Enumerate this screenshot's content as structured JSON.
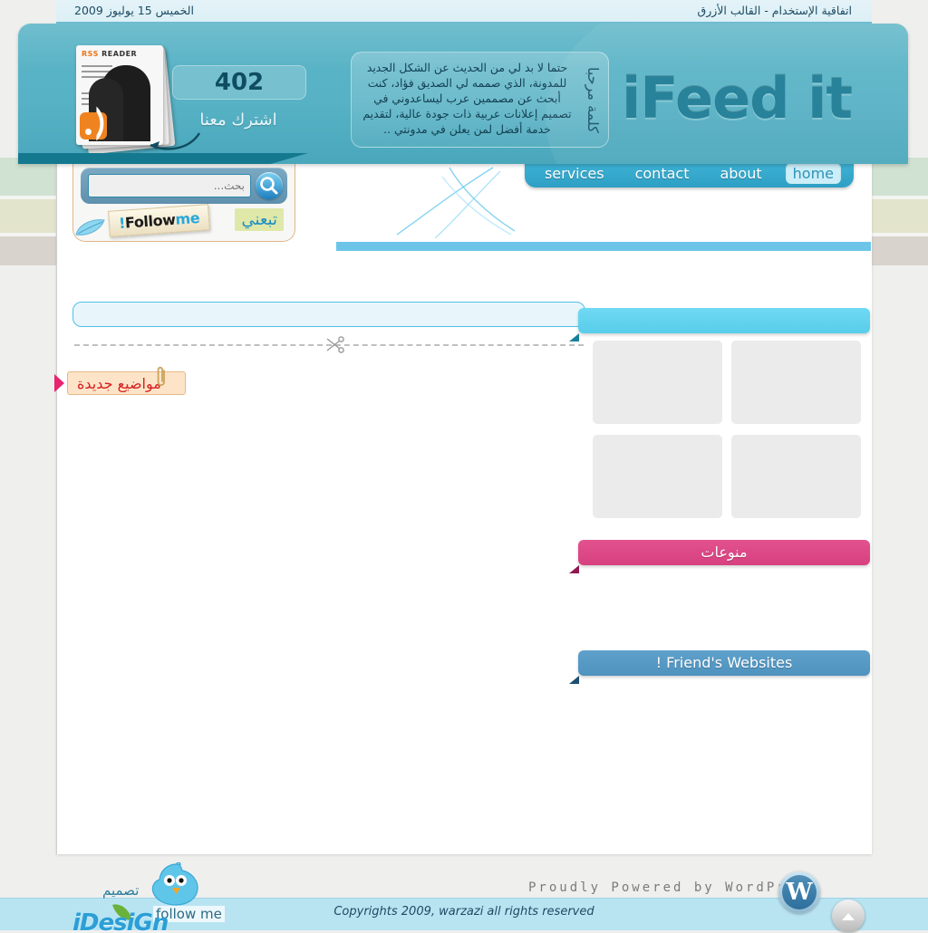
{
  "topbar": {
    "terms_label": "اتفاقية الإستخدام - القالب الأزرق",
    "date": "الخميس 15 يوليوز 2009"
  },
  "header": {
    "logo": "iFeed it",
    "description": "حتما لا بد لي من الحديث عن الشكل الجديد للمدونة، الذي صممه لي الصديق فؤاد، كنت أبحث عن مصممين عرب ليساعدوني في تصميم إعلانات عربية ذات جودة عالية، لتقديم خدمة أفضل لمن يعلن في مدونتي ..",
    "description_vertical": "كلمة مرحبا",
    "rss": {
      "icon_title_1": "RSS",
      "icon_title_2": "READER",
      "count": "402",
      "subscribe_label": "اشترك معنا"
    }
  },
  "search": {
    "placeholder": "بحث...",
    "value": ""
  },
  "follow": {
    "badge_en_1": "Follow",
    "badge_en_2": "me!",
    "badge_ar": "تبعني"
  },
  "nav": {
    "items": [
      {
        "label": "services",
        "active": false
      },
      {
        "label": "contact",
        "active": false
      },
      {
        "label": "about",
        "active": false
      },
      {
        "label": "home",
        "active": true
      }
    ]
  },
  "content": {
    "new_topics_label": "مواضيع جديدة"
  },
  "sidebar": {
    "widgets": [
      {
        "id": "featured",
        "title": "",
        "color": "cyan"
      },
      {
        "id": "varied",
        "title": "منوعات",
        "color": "pink"
      },
      {
        "id": "friends",
        "title": "Friend's Websites !",
        "color": "blue"
      }
    ],
    "thumbs": [
      "",
      "",
      "",
      ""
    ]
  },
  "footer": {
    "wordpress_credit": "Proudly Powered by WordPress",
    "wordpress_mark": "W",
    "copyright": "Copyrights 2009, warzazi all rights reserved",
    "to_top_label": "▲",
    "twitter_follow": "follow me",
    "design_ar": "تصميم",
    "design_logo": "iDesiGn"
  },
  "colors": {
    "header_teal": "#57b2c5",
    "logo_teal": "#1a7b94",
    "nav_blue": "#2f9fc4",
    "ribbon_cyan": "#58cdea",
    "ribbon_pink": "#d8407f",
    "ribbon_blue": "#4e92be",
    "accent_pink": "#e8246e",
    "new_topics_red": "#d62020",
    "footer_bar": "#b8e4f2",
    "band_green": "#d0e2d2",
    "band_beige": "#e3e4cc",
    "band_gray": "#d9d3cd"
  }
}
